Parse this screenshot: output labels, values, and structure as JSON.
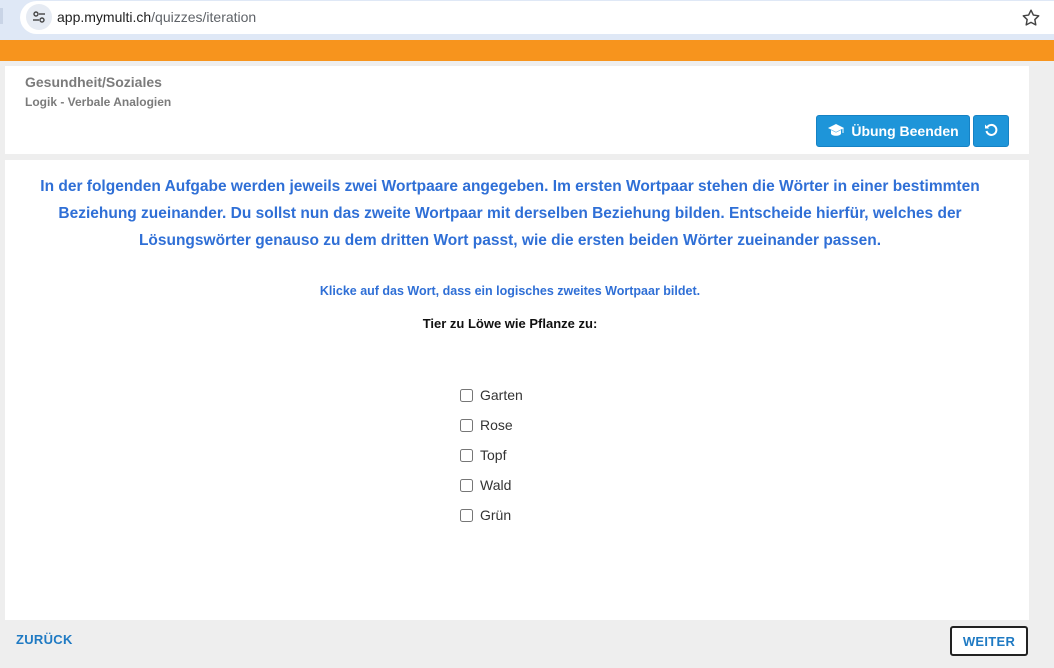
{
  "browser": {
    "url_host": "app.mymulti.ch",
    "url_path": "/quizzes/iteration"
  },
  "header": {
    "category": "Gesundheit/Soziales",
    "subcategory": "Logik - Verbale Analogien",
    "end_button_label": "Übung Beenden"
  },
  "main": {
    "instructions": "In der folgenden Aufgabe werden jeweils zwei Wortpaare angegeben. Im ersten Wortpaar stehen die Wörter in einer bestimmten Beziehung zueinander. Du sollst nun das zweite Wortpaar mit derselben Beziehung bilden. Entscheide hierfür, welches der Lösungswörter genauso zu dem dritten Wort passt, wie die ersten beiden Wörter zueinander passen.",
    "hint": "Klicke auf das Wort, dass ein logisches zweites Wortpaar bildet.",
    "question": "Tier zu Löwe wie Pflanze zu:",
    "options": [
      {
        "label": "Garten"
      },
      {
        "label": "Rose"
      },
      {
        "label": "Topf"
      },
      {
        "label": "Wald"
      },
      {
        "label": "Grün"
      }
    ]
  },
  "footer": {
    "back_label": "ZURÜCK",
    "next_label": "WEITER"
  },
  "colors": {
    "accent_orange": "#f7941d",
    "button_blue": "#1e95d9",
    "text_blue": "#2f6fd6"
  }
}
